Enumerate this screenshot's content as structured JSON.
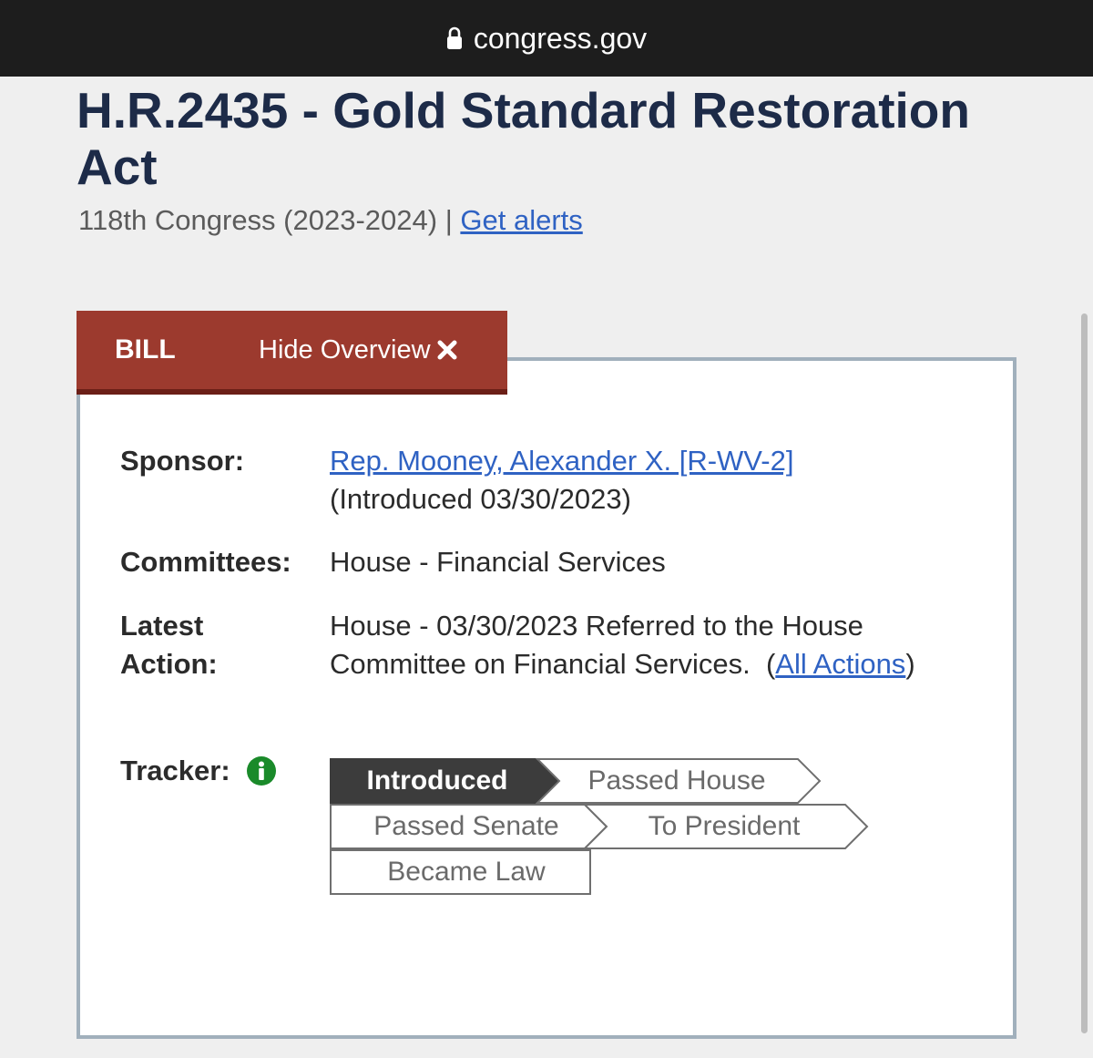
{
  "browser": {
    "url": "congress.gov"
  },
  "bill": {
    "title": "H.R.2435 - Gold Standard Restoration Act",
    "congress": "118th Congress (2023-2024)",
    "separator": "|",
    "alerts_link": "Get alerts"
  },
  "overview": {
    "tab_label": "BILL",
    "hide_label": "Hide Overview",
    "sponsor_label": "Sponsor:",
    "sponsor_name": "Rep. Mooney, Alexander X. [R-WV-2]",
    "sponsor_intro": "(Introduced 03/30/2023)",
    "committees_label": "Committees:",
    "committees_value": "House - Financial Services",
    "latest_action_label_1": "Latest",
    "latest_action_label_2": "Action:",
    "latest_action_text": "House - 03/30/2023 Referred to the House Committee on Financial Services.",
    "open_paren": "(",
    "all_actions_link": "All Actions",
    "close_paren": ")",
    "tracker_label": "Tracker:"
  },
  "tracker": {
    "steps": [
      "Introduced",
      "Passed House",
      "Passed Senate",
      "To President",
      "Became Law"
    ],
    "current_step": "Introduced"
  },
  "colors": {
    "tab_red": "#9c3a2e",
    "title_navy": "#1d2b48",
    "link_blue": "#2f62c3",
    "info_green": "#1a8a2a",
    "active_step": "#3c3c3c"
  }
}
